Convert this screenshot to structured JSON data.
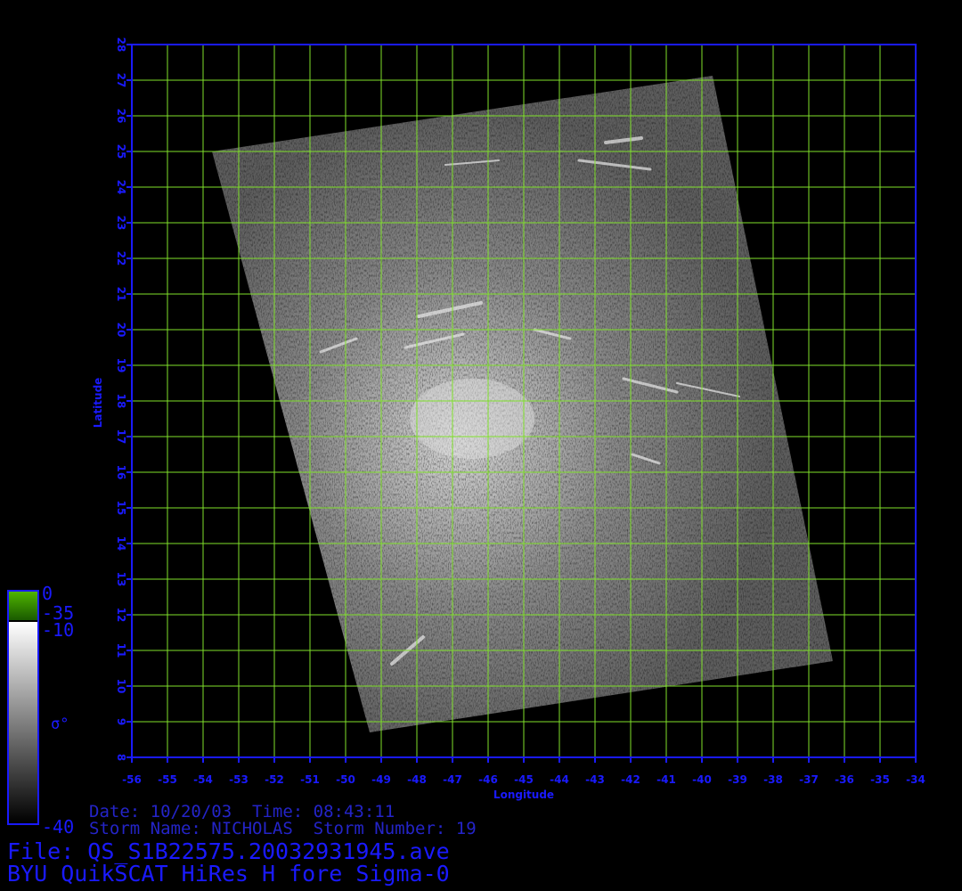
{
  "map": {
    "x_axis_label": "Longitude",
    "y_axis_label": "Latitude",
    "lon_range": [
      -56,
      -34
    ],
    "lat_range": [
      8,
      28
    ],
    "lon_ticks": [
      "-56",
      "-55",
      "-54",
      "-53",
      "-52",
      "-51",
      "-50",
      "-49",
      "-48",
      "-47",
      "-46",
      "-45",
      "-44",
      "-43",
      "-42",
      "-41",
      "-40",
      "-39",
      "-38",
      "-37",
      "-36",
      "-35",
      "-34"
    ],
    "lat_ticks": [
      "8",
      "9",
      "10",
      "11",
      "12",
      "13",
      "14",
      "15",
      "16",
      "17",
      "18",
      "19",
      "20",
      "21",
      "22",
      "23",
      "24",
      "25",
      "26",
      "27",
      "28"
    ],
    "grid_color": "#7fe02a",
    "frame_color": "#1a1aff"
  },
  "colorbar": {
    "symbol": "σ°",
    "labels": {
      "top": "0",
      "green_bottom": "-35",
      "gray_top": "-10",
      "bottom": "-40"
    },
    "green_color": "#3aa000"
  },
  "info": {
    "date_line": "Date: 10/20/03  Time: 08:43:11",
    "storm_line": "Storm Name: NICHOLAS  Storm Number: 19",
    "file_line": "File: QS_S1B22575.20032931945.ave",
    "product_line": "BYU QuikSCAT HiRes H fore Sigma-0"
  }
}
